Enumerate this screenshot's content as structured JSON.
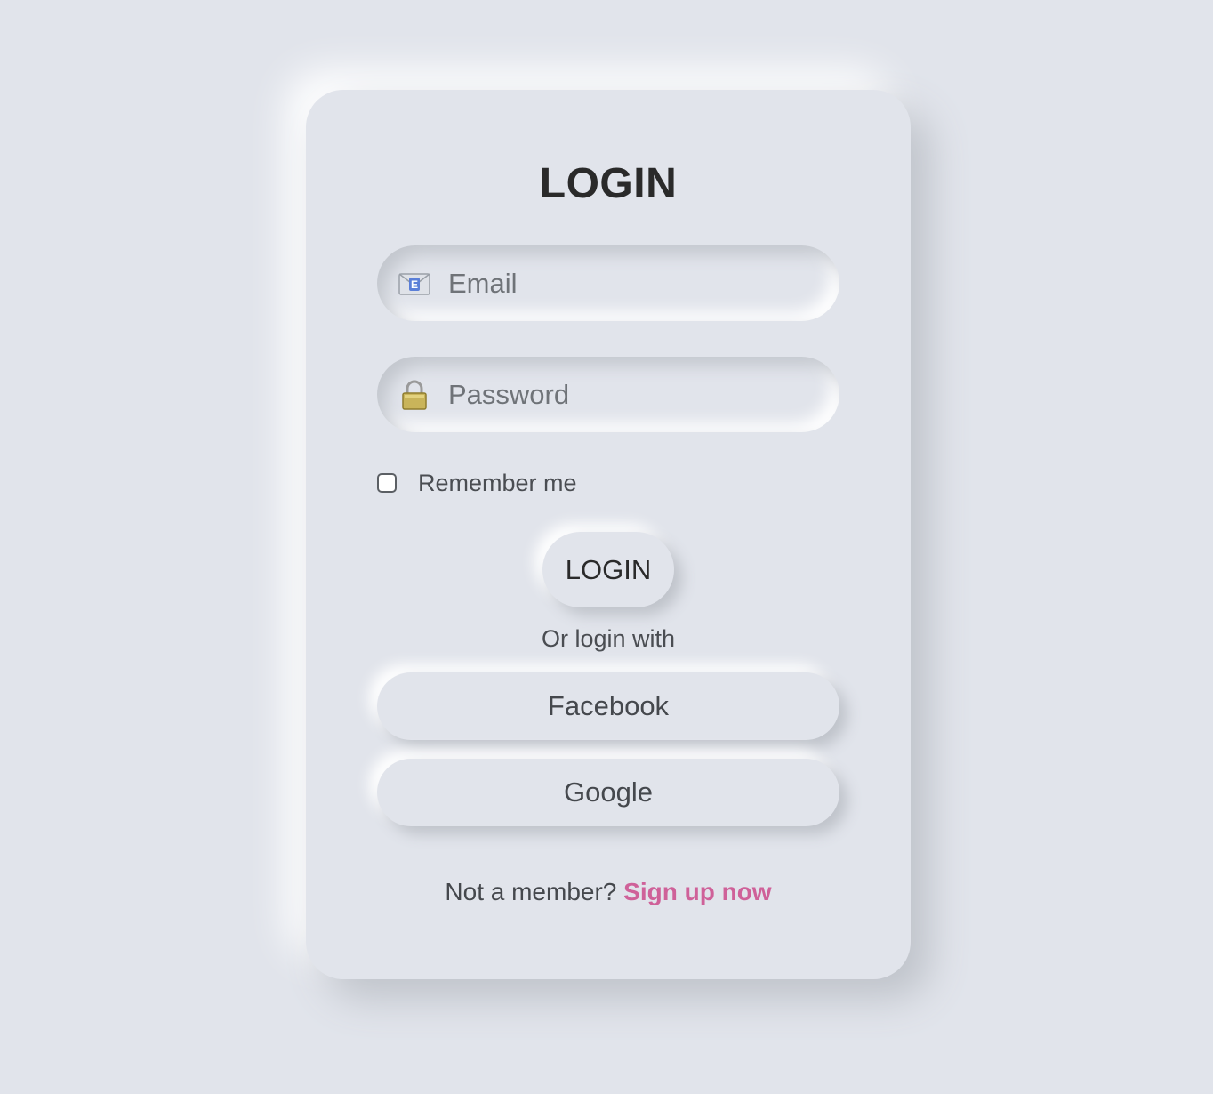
{
  "form": {
    "title": "LOGIN",
    "email": {
      "placeholder": "Email",
      "value": "",
      "icon": "envelope-icon"
    },
    "password": {
      "placeholder": "Password",
      "value": "",
      "icon": "lock-icon"
    },
    "remember": {
      "label": "Remember me",
      "checked": false
    },
    "submit_label": "LOGIN"
  },
  "social": {
    "divider_text": "Or login with",
    "buttons": [
      {
        "label": "Facebook"
      },
      {
        "label": "Google"
      }
    ]
  },
  "footer": {
    "prompt": "Not a member?",
    "link_label": "Sign up now"
  },
  "colors": {
    "background": "#e1e4eb",
    "link": "#cf6199",
    "text": "#2a2a2a"
  }
}
